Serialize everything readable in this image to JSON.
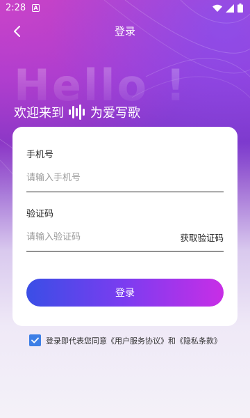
{
  "status_bar": {
    "time": "2:28",
    "notification_letter": "A"
  },
  "header": {
    "title": "登录"
  },
  "hero": {
    "hello": "Hello !",
    "welcome_prefix": "欢迎来到",
    "welcome_suffix": "为爱写歌"
  },
  "form": {
    "phone_label": "手机号",
    "phone_placeholder": "请输入手机号",
    "phone_value": "",
    "code_label": "验证码",
    "code_placeholder": "请输入验证码",
    "code_value": "",
    "get_code_label": "获取验证码",
    "login_label": "登录"
  },
  "agreement": {
    "checked": true,
    "text_prefix": "登录即代表您同意",
    "user_agreement": "《用户服务协议》",
    "conjunction": "和",
    "privacy_policy": "《隐私条款》"
  }
}
